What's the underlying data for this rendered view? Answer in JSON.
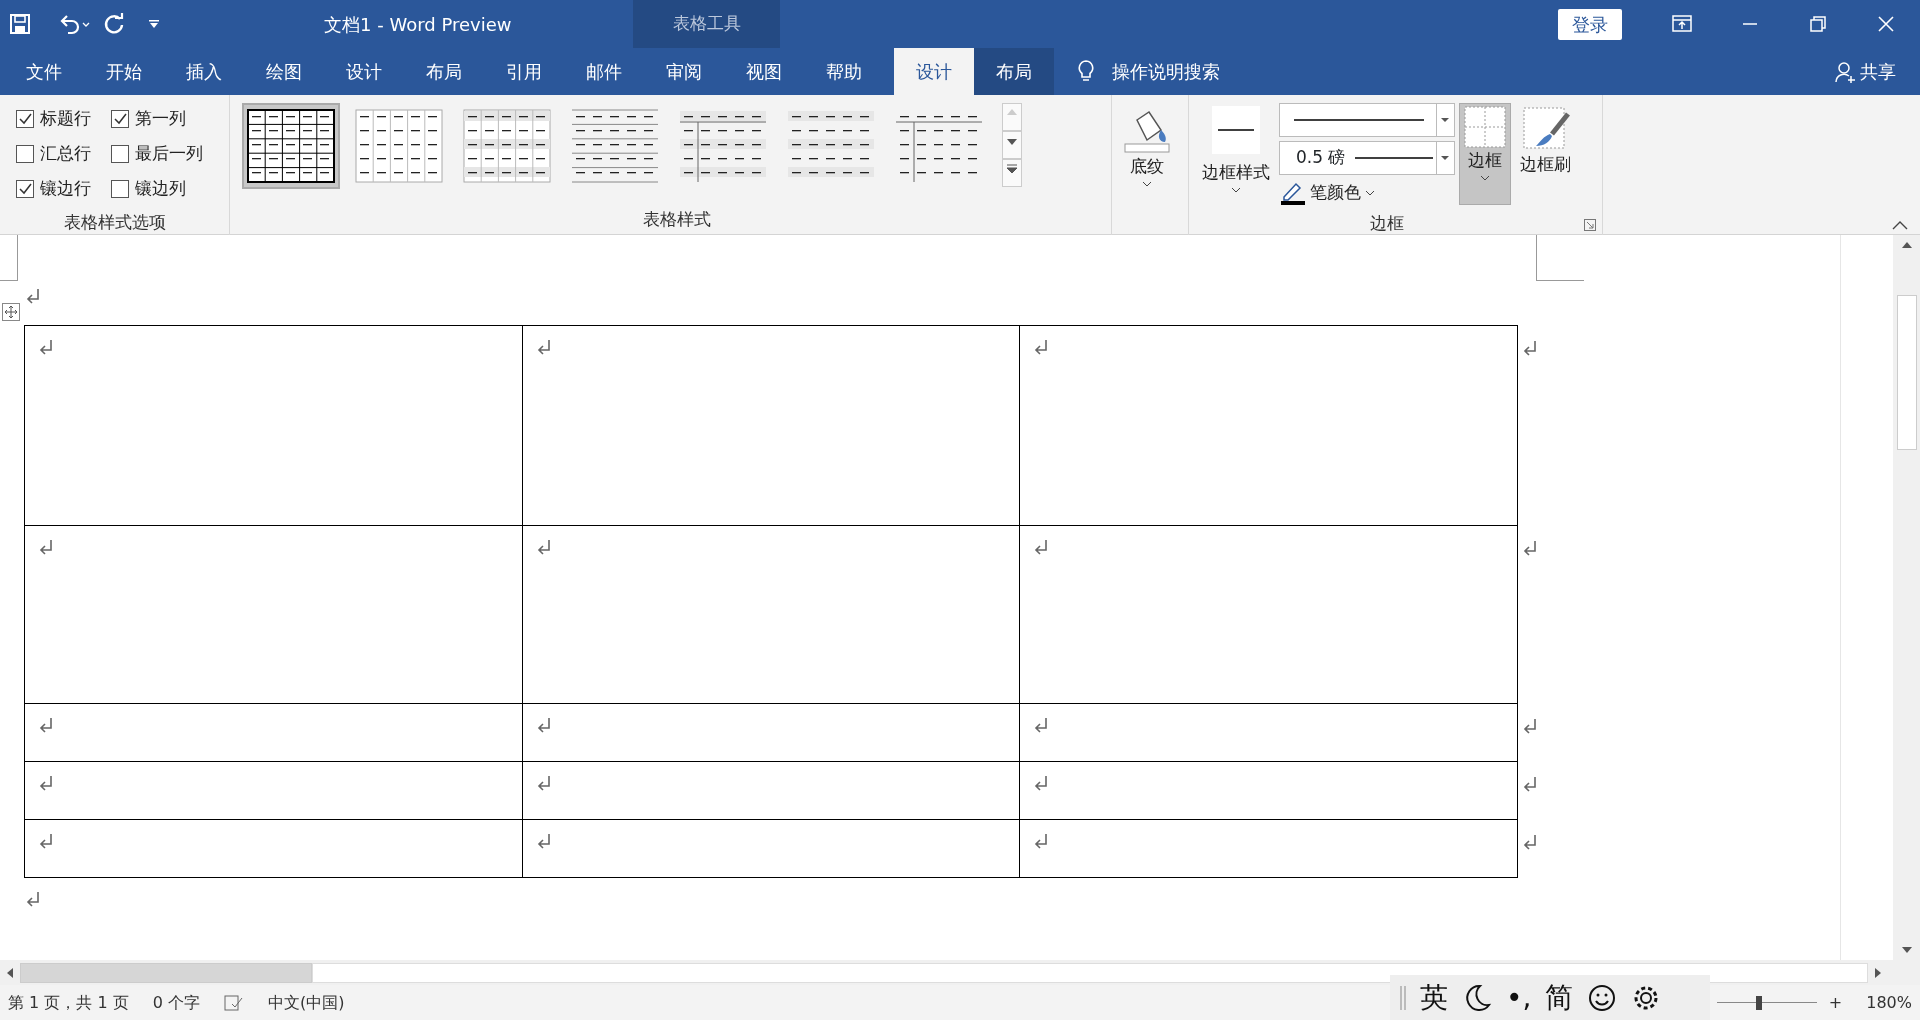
{
  "window": {
    "title": "文档1  -  Word Preview",
    "context_label": "表格工具",
    "login_button": "登录"
  },
  "tabs": [
    {
      "label": "文件",
      "selected": false,
      "kind": "normal"
    },
    {
      "label": "开始",
      "selected": false,
      "kind": "normal"
    },
    {
      "label": "插入",
      "selected": false,
      "kind": "normal"
    },
    {
      "label": "绘图",
      "selected": false,
      "kind": "normal"
    },
    {
      "label": "设计",
      "selected": false,
      "kind": "normal"
    },
    {
      "label": "布局",
      "selected": false,
      "kind": "normal"
    },
    {
      "label": "引用",
      "selected": false,
      "kind": "normal"
    },
    {
      "label": "邮件",
      "selected": false,
      "kind": "normal"
    },
    {
      "label": "审阅",
      "selected": false,
      "kind": "normal"
    },
    {
      "label": "视图",
      "selected": false,
      "kind": "normal"
    },
    {
      "label": "帮助",
      "selected": false,
      "kind": "normal"
    },
    {
      "label": "设计",
      "selected": true,
      "kind": "context"
    },
    {
      "label": "布局",
      "selected": false,
      "kind": "context"
    }
  ],
  "tell_me": "操作说明搜索",
  "share": "共享",
  "style_options": {
    "label": "表格样式选项",
    "items": [
      {
        "label": "标题行",
        "checked": true
      },
      {
        "label": "第一列",
        "checked": true
      },
      {
        "label": "汇总行",
        "checked": false
      },
      {
        "label": "最后一列",
        "checked": false
      },
      {
        "label": "镶边行",
        "checked": true
      },
      {
        "label": "镶边列",
        "checked": false
      }
    ]
  },
  "table_styles": {
    "label": "表格样式",
    "gallery": [
      {
        "kind": "grid",
        "selected": true
      },
      {
        "kind": "light-grid",
        "selected": false
      },
      {
        "kind": "shaded-grid",
        "selected": false
      },
      {
        "kind": "lines",
        "selected": false
      },
      {
        "kind": "shaded-column",
        "selected": false
      },
      {
        "kind": "shaded",
        "selected": false
      },
      {
        "kind": "column",
        "selected": false
      }
    ]
  },
  "shading": {
    "label": "底纹"
  },
  "borders": {
    "label": "边框",
    "border_styles": "边框样式",
    "weight": "0.5 磅",
    "pen_color": "笔颜色",
    "borders_button": {
      "label": "边框",
      "pressed": true
    },
    "painter": "边框刷"
  },
  "document": {
    "table": {
      "rows": [
        {
          "kind": "large"
        },
        {
          "kind": "medium"
        },
        {
          "kind": "small"
        },
        {
          "kind": "small"
        },
        {
          "kind": "small"
        }
      ]
    }
  },
  "status_bar": {
    "page": "第 1 页，共 1 页",
    "words": "0 个字",
    "language": "中文(中国)",
    "zoom_plus": "+",
    "zoom": "180%",
    "zoom_level": {
      "level": 0.42
    }
  },
  "ime_toolbar": {
    "mode": "英",
    "punctuation": "•,",
    "script": "简"
  }
}
